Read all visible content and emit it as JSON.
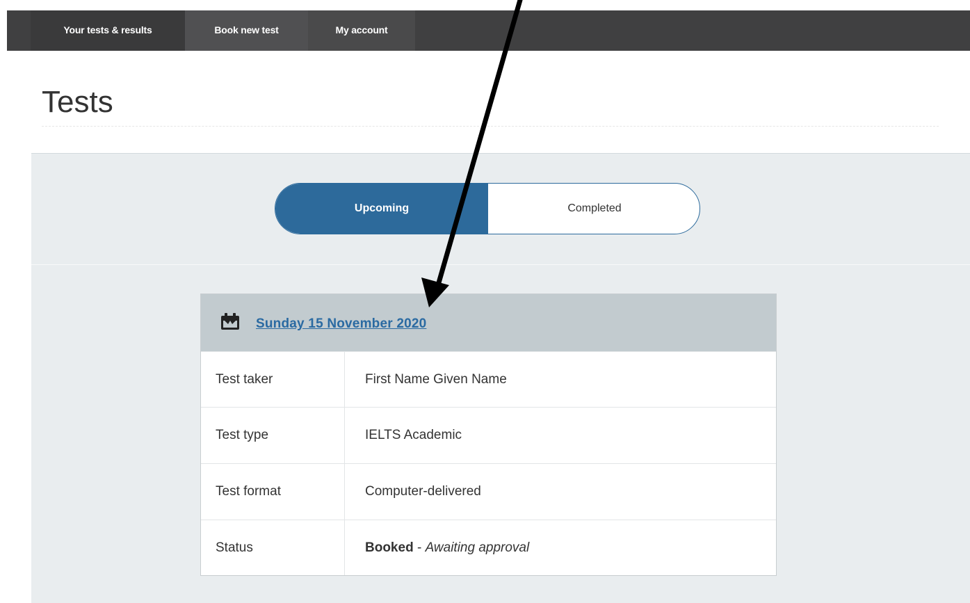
{
  "nav": {
    "items": [
      {
        "label": "Your tests & results"
      },
      {
        "label": "Book new test"
      },
      {
        "label": "My account"
      }
    ]
  },
  "page": {
    "title": "Tests"
  },
  "toggle": {
    "upcoming": "Upcoming",
    "completed": "Completed",
    "selected": "Upcoming"
  },
  "card": {
    "date": "Sunday 15 November 2020",
    "icon": "calendar-icon",
    "rows": [
      {
        "label": "Test taker",
        "value": "First Name Given Name"
      },
      {
        "label": "Test type",
        "value": "IELTS Academic"
      },
      {
        "label": "Test format",
        "value": "Computer-delivered"
      },
      {
        "label": "Status",
        "value_bold": "Booked",
        "value_sep": " - ",
        "value_italic": "Awaiting approval"
      }
    ]
  },
  "colors": {
    "nav_bg": "#404041",
    "accent": "#2d6a9b",
    "link": "#2a6aa2",
    "panel_bg": "#e9edef",
    "card_header": "#c2cbcf"
  }
}
